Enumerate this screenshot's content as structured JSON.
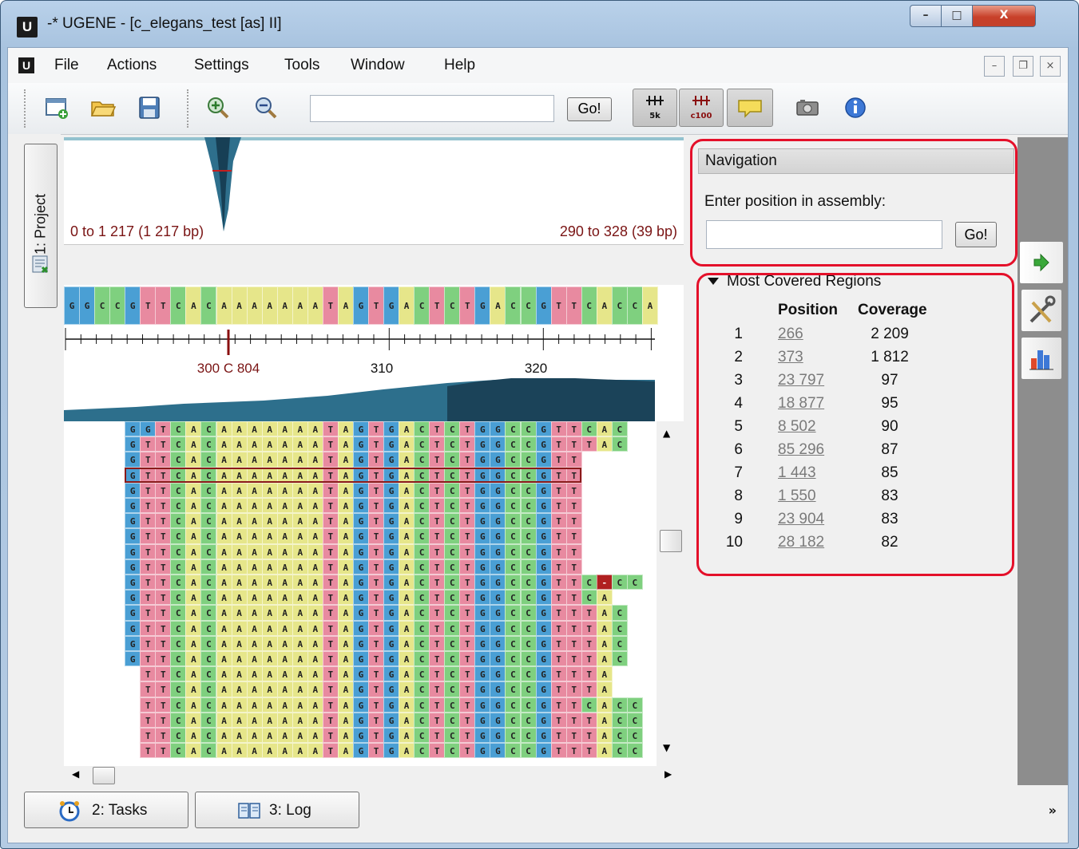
{
  "window": {
    "title": "-* UGENE - [c_elegans_test [as] II]",
    "app_icon": "U",
    "controls": {
      "minimize": "–",
      "maximize": "□",
      "close": "X"
    }
  },
  "menu": {
    "items": [
      "File",
      "Actions",
      "Settings",
      "Tools",
      "Window",
      "Help"
    ],
    "mdi": {
      "minimize": "–",
      "restore": "❐",
      "close": "×"
    }
  },
  "toolbar": {
    "go_label": "Go!",
    "icons": [
      "new-document-icon",
      "open-folder-icon",
      "save-icon",
      "zoom-in-icon",
      "zoom-out-icon",
      "ruler-5k-icon",
      "ruler-c100-icon",
      "hint-icon",
      "snapshot-icon",
      "info-icon"
    ],
    "ruler_5k_text": "5k",
    "ruler_c100_text": "c100"
  },
  "left_panel": {
    "project_tab": "1: Project"
  },
  "overview": {
    "left_label": "0 to 1 217 (1 217 bp)",
    "right_label": "290 to 328 (39 bp)"
  },
  "reference": {
    "sequence": "GGCCGTTCACAAAAAAATAGTGACTCTGACCGTTCACCA"
  },
  "ruler": {
    "cursor_label": "300 C 804",
    "tick_310": "310",
    "tick_320": "320"
  },
  "reads": {
    "rows": [
      {
        "start": 4,
        "seq": "GGTCACAAAAAAATAGTGACTCTGGCCGTTCAC"
      },
      {
        "start": 4,
        "seq": "GTTCACAAAAAAATAGTGACTCTGGCCGTTTAC"
      },
      {
        "start": 4,
        "seq": "GTTCACAAAAAAATAGTGACTCTGGCCGTT"
      },
      {
        "start": 4,
        "seq": "GTTCACAAAAAAATAGTGACTCTGGCCGTT"
      },
      {
        "start": 4,
        "seq": "GTTCACAAAAAAATAGTGACTCTGGCCGTT"
      },
      {
        "start": 4,
        "seq": "GTTCACAAAAAAATAGTGACTCTGGCCGTT"
      },
      {
        "start": 4,
        "seq": "GTTCACAAAAAAATAGTGACTCTGGCCGTT"
      },
      {
        "start": 4,
        "seq": "GTTCACAAAAAAATAGTGACTCTGGCCGTT"
      },
      {
        "start": 4,
        "seq": "GTTCACAAAAAAATAGTGACTCTGGCCGTT"
      },
      {
        "start": 4,
        "seq": "GTTCACAAAAAAATAGTGACTCTGGCCGTT"
      },
      {
        "start": 4,
        "seq": "GTTCACAAAAAAATAGTGACTCTGGCCGTTC-CC"
      },
      {
        "start": 4,
        "seq": "GTTCACAAAAAAATAGTGACTCTGGCCGTTCA"
      },
      {
        "start": 4,
        "seq": "GTTCACAAAAAAATAGTGACTCTGGCCGTTTAC"
      },
      {
        "start": 4,
        "seq": "GTTCACAAAAAAATAGTGACTCTGGCCGTTTAC"
      },
      {
        "start": 4,
        "seq": "GTTCACAAAAAAATAGTGACTCTGGCCGTTTAC"
      },
      {
        "start": 4,
        "seq": "GTTCACAAAAAAATAGTGACTCTGGCCGTTTAC"
      },
      {
        "start": 5,
        "seq": "TTCACAAAAAAATAGTGACTCTGGCCGTTTA"
      },
      {
        "start": 5,
        "seq": "TTCACAAAAAAATAGTGACTCTGGCCGTTTA"
      },
      {
        "start": 5,
        "seq": "TTCACAAAAAAATAGTGACTCTGGCCGTTCACC"
      },
      {
        "start": 5,
        "seq": "TTCACAAAAAAATAGTGACTCTGGCCGTTTACC"
      },
      {
        "start": 5,
        "seq": "TTCACAAAAAAATAGTGACTCTGGCCGTTTACC"
      },
      {
        "start": 5,
        "seq": "TTCACAAAAAAATAGTGACTCTGGCCGTTTACC"
      }
    ]
  },
  "colors": {
    "A": "#e6e68a",
    "C": "#7fd07f",
    "G": "#4a9fd4",
    "T": "#e88aa0",
    "gap": "#b02020",
    "highlight": "#e4102a",
    "coverage": "#2d6f8c"
  },
  "navigation": {
    "header": "Navigation",
    "label": "Enter position in assembly:",
    "input_value": "",
    "go_label": "Go!"
  },
  "most_covered": {
    "title": "Most Covered Regions",
    "col_position": "Position",
    "col_coverage": "Coverage",
    "rows": [
      {
        "idx": "1",
        "position": "266",
        "coverage": "2 209"
      },
      {
        "idx": "2",
        "position": "373",
        "coverage": "1 812"
      },
      {
        "idx": "3",
        "position": "23 797",
        "coverage": "97"
      },
      {
        "idx": "4",
        "position": "18 877",
        "coverage": "95"
      },
      {
        "idx": "5",
        "position": "8 502",
        "coverage": "90"
      },
      {
        "idx": "6",
        "position": "85 296",
        "coverage": "87"
      },
      {
        "idx": "7",
        "position": "1 443",
        "coverage": "85"
      },
      {
        "idx": "8",
        "position": "1 550",
        "coverage": "83"
      },
      {
        "idx": "9",
        "position": "23 904",
        "coverage": "83"
      },
      {
        "idx": "10",
        "position": "28 182",
        "coverage": "82"
      }
    ]
  },
  "status": {
    "tasks": "2: Tasks",
    "log": "3: Log",
    "more": "»"
  }
}
